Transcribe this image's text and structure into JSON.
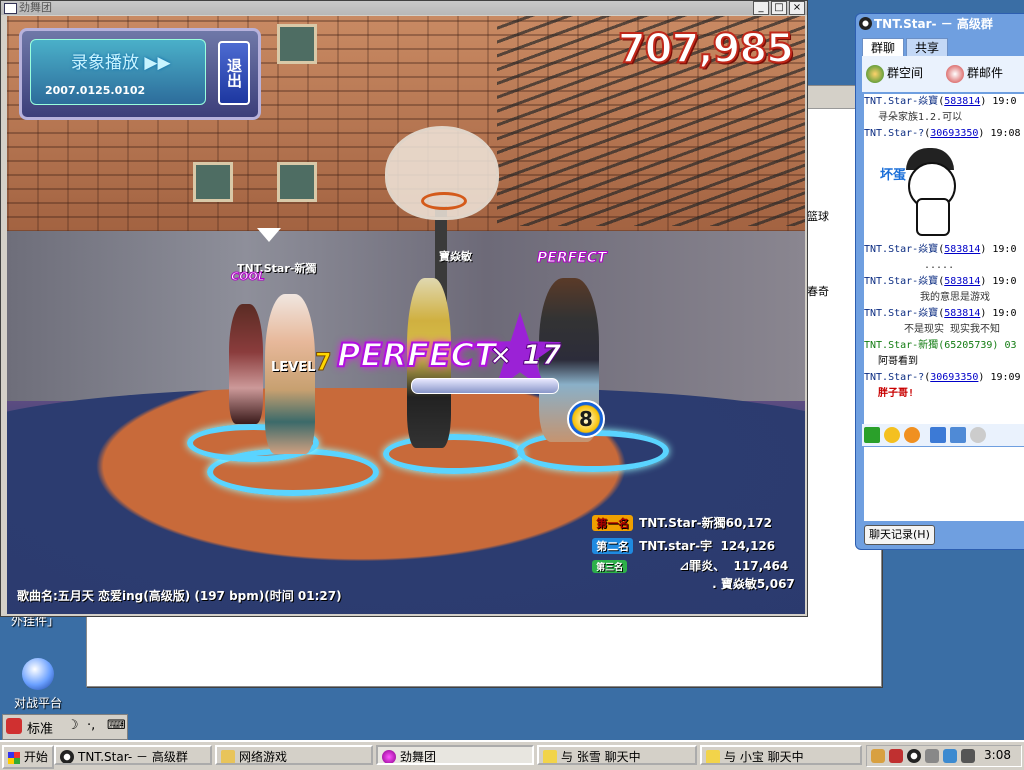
{
  "game_window": {
    "title": "劲舞团",
    "controls": {
      "minimize": "_",
      "maximize": "□",
      "close": "×"
    }
  },
  "replay": {
    "label": "录象播放",
    "arrows": "▶▶",
    "timestamp": "2007.0125.0102",
    "exit_label": "退出"
  },
  "hud": {
    "score": "707,985",
    "perfect_big": "PERFECT",
    "combo": "17",
    "level_label": "LEVEL",
    "level_value": "7",
    "beat_counter": "8",
    "player_perfect": "PERFECT",
    "player_cool": "COOL"
  },
  "players": [
    {
      "label": "TNT.Star-新獨"
    },
    {
      "label": "寶焱敏"
    },
    {
      "label": "TNT.star-宇"
    }
  ],
  "ranking": [
    {
      "tag": "第一名",
      "name": "TNT.Star-新獨",
      "score": "60,172",
      "color": "#f0a000"
    },
    {
      "tag": "第二名",
      "name": "TNT.star-宇",
      "score": "124,126",
      "color": "#1f8ae0"
    },
    {
      "tag": "第三名",
      "name": "⊿罪炎、",
      "score": "117,464",
      "color": "#2db04a"
    },
    {
      "tag": "",
      "name": ". 寶焱敏",
      "score": "5,067",
      "color": ""
    }
  ],
  "song_info": "歌曲名:五月天 恋爱ing(高级版) (197 bpm)(时间 01:27)",
  "desktop": {
    "icon_label": "对战平台",
    "partial_label": "外挂件」",
    "bg_labels": [
      "篮球",
      "春奇"
    ]
  },
  "chat": {
    "title": "TNT.Star- － 高级群",
    "tabs": [
      "群聊",
      "共享"
    ],
    "tools": [
      {
        "label": "群空间",
        "icon": "group-space-icon"
      },
      {
        "label": "群邮件",
        "icon": "group-mail-icon"
      }
    ],
    "sticker_text": "坏蛋",
    "messages": [
      {
        "name": "TNT.Star-焱寶",
        "id": "583814",
        "time": "19:0",
        "body": "寻朵家族1.2.可以",
        "style": ""
      },
      {
        "name": "TNT.Star-?",
        "id": "30693350",
        "time": "19:08",
        "body": "",
        "style": "sticker"
      },
      {
        "name": "TNT.Star-焱寶",
        "id": "583814",
        "time": "19:0",
        "body": ".....",
        "style": ""
      },
      {
        "name": "TNT.Star-焱寶",
        "id": "583814",
        "time": "19:0",
        "body": "我的意思是游戏",
        "style": ""
      },
      {
        "name": "TNT.Star-焱寶",
        "id": "583814",
        "time": "19:0",
        "body": "不是现实  现实我不知",
        "style": ""
      },
      {
        "name": "TNT.Star-新獨",
        "id": "65205739",
        "time": "03",
        "body": "阿哥看到",
        "style": "green"
      },
      {
        "name": "TNT.Star-?",
        "id": "30693350",
        "time": "19:09",
        "body": "胖子哥!",
        "style": "red"
      }
    ],
    "history_button": "聊天记录(H)"
  },
  "ime": {
    "mode": "标准",
    "moon": "☽",
    "dot": "·,",
    "kbd": "⌨"
  },
  "taskbar": {
    "start": "开始",
    "tasks": [
      {
        "label": "TNT.Star- － 高级群",
        "pressed": false
      },
      {
        "label": "网络游戏",
        "pressed": false
      },
      {
        "label": "劲舞团",
        "pressed": true
      },
      {
        "label": "与 张雪 聊天中",
        "pressed": false
      },
      {
        "label": "与 小宝 聊天中",
        "pressed": false
      }
    ],
    "clock": "3:08"
  }
}
